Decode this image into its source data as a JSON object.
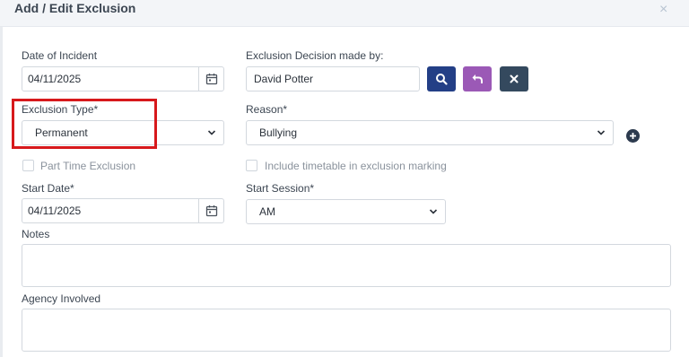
{
  "modal": {
    "title": "Add / Edit Exclusion",
    "close_glyph": "×"
  },
  "form": {
    "date_of_incident": {
      "label": "Date of Incident",
      "value": "04/11/2025"
    },
    "decision_by": {
      "label": "Exclusion Decision made by:",
      "value": "David Potter"
    },
    "exclusion_type": {
      "label": "Exclusion Type*",
      "value": "Permanent"
    },
    "reason": {
      "label": "Reason*",
      "value": "Bullying"
    },
    "part_time": {
      "label": "Part Time Exclusion",
      "checked": false
    },
    "include_timetable": {
      "label": "Include timetable in exclusion marking",
      "checked": false
    },
    "start_date": {
      "label": "Start Date*",
      "value": "04/11/2025"
    },
    "start_session": {
      "label": "Start Session*",
      "value": "AM"
    },
    "notes": {
      "label": "Notes",
      "value": ""
    },
    "agency": {
      "label": "Agency Involved",
      "value": ""
    }
  },
  "buttons": {
    "search": {
      "icon": "search-icon",
      "color": "#233f86"
    },
    "undo": {
      "icon": "undo-icon",
      "color": "#9b59b6"
    },
    "clear": {
      "icon": "close-icon",
      "color": "#34495e"
    }
  },
  "colors": {
    "highlight": "#d7191c",
    "header_bg": "#f3f5f8"
  }
}
